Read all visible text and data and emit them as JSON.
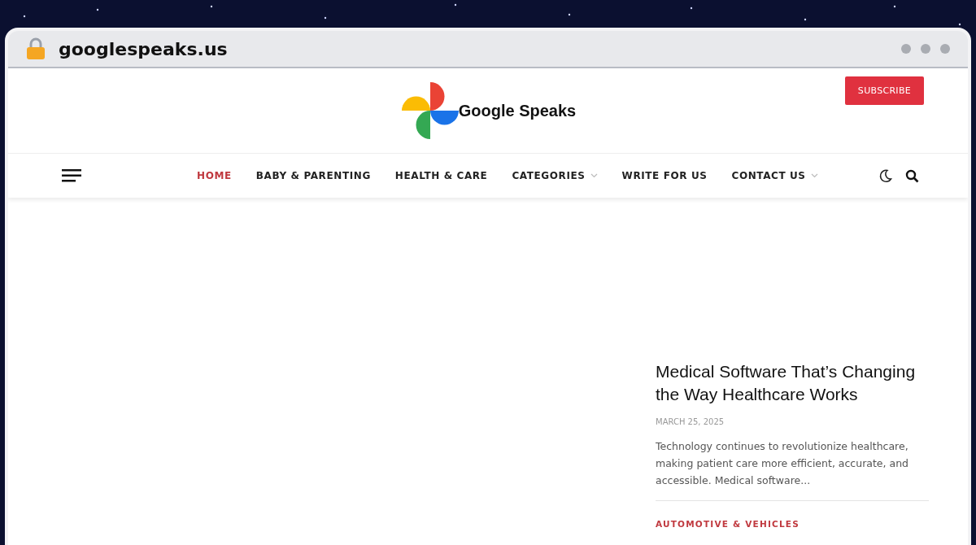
{
  "browser": {
    "url": "googlespeaks.us"
  },
  "header": {
    "logo_text": "Google Speaks",
    "subscribe": "SUBSCRIBE"
  },
  "nav": {
    "items": [
      {
        "label": "HOME",
        "selected": true,
        "has_dropdown": false
      },
      {
        "label": "BABY & PARENTING",
        "selected": false,
        "has_dropdown": false
      },
      {
        "label": "HEALTH & CARE",
        "selected": false,
        "has_dropdown": false
      },
      {
        "label": "CATEGORIES",
        "selected": false,
        "has_dropdown": true
      },
      {
        "label": "WRITE FOR US",
        "selected": false,
        "has_dropdown": false
      },
      {
        "label": "CONTACT US",
        "selected": false,
        "has_dropdown": true
      }
    ]
  },
  "posts": [
    {
      "title": "Medical Software That’s Changing the Way Healthcare Works",
      "date": "MARCH 25, 2025",
      "excerpt": "Technology continues to revolutionize healthcare, making patient care more efficient, accurate, and accessible. Medical software..."
    },
    {
      "category": "AUTOMOTIVE & VEHICLES"
    }
  ]
}
